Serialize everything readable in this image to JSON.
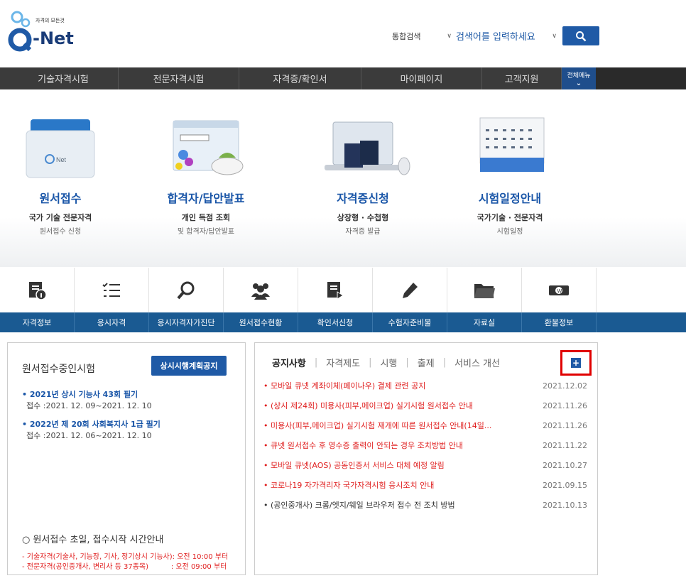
{
  "logo": {
    "tagline": "자격의 모든것",
    "brand": "-Net"
  },
  "search": {
    "scope": "통합검색",
    "placeholder": "검색어를 입력하세요"
  },
  "gnb": {
    "items": [
      "기술자격시험",
      "전문자격시험",
      "자격증/확인서",
      "마이페이지",
      "고객지원"
    ],
    "allmenu": "전체메뉴"
  },
  "quick": [
    {
      "title": "원서접수",
      "sub1": "국가 기술 전문자격",
      "sub2": "원서접수 신청"
    },
    {
      "title": "합격자/답안발표",
      "sub1": "개인 득점 조회",
      "sub2": "및 합격자/답안발표"
    },
    {
      "title": "자격증신청",
      "sub1": "상장형 · 수첩형",
      "sub2": "자격증 발급"
    },
    {
      "title": "시험일정안내",
      "sub1": "국가기술 · 전문자격",
      "sub2": "시험일정"
    }
  ],
  "icon_menu": [
    {
      "label": "자격정보",
      "icon": "document-info-icon"
    },
    {
      "label": "응시자격",
      "icon": "checklist-icon"
    },
    {
      "label": "응시자격자가진단",
      "icon": "search-icon"
    },
    {
      "label": "원서접수현황",
      "icon": "users-icon"
    },
    {
      "label": "확인서신청",
      "icon": "document-arrow-icon"
    },
    {
      "label": "수험자준비물",
      "icon": "pencil-icon"
    },
    {
      "label": "자료실",
      "icon": "folder-icon"
    },
    {
      "label": "환불정보",
      "icon": "money-icon"
    }
  ],
  "ongoing": {
    "title": "원서접수중인시험",
    "button": "상시시행계획공지",
    "exams": [
      {
        "title": "• 2021년 상시 기능사 43회 필기",
        "period": "접수 :2021. 12. 09~2021. 12. 10"
      },
      {
        "title": "• 2022년 제 20회 사회복지사 1급 필기",
        "period": "접수 :2021. 12. 06~2021. 12. 10"
      }
    ],
    "time_title": "○ 원서접수 초일, 접수시작 시간안내",
    "time_lines": [
      "- 기술자격(기술사, 기능장, 기사, 정기상시 기능사): 오전 10:00 부터",
      "- 전문자격(공인중개사, 변리사 등 37종목)          : 오전 09:00 부터"
    ]
  },
  "notice": {
    "tabs": [
      "공지사항",
      "자격제도",
      "시행",
      "출제",
      "서비스 개선"
    ],
    "more": "+",
    "items": [
      {
        "title": "• 모바일 큐넷 계좌이체(페이나우) 결제 관련 공지",
        "date": "2021.12.02",
        "color": "#e02020"
      },
      {
        "title": "• (상시 제24회) 미용사(피부,메이크업) 실기시험 원서접수 안내",
        "date": "2021.11.26",
        "color": "#e02020"
      },
      {
        "title": "• 미용사(피부,메이크업) 실기시험 재개에 따른 원서접수 안내(14일...",
        "date": "2021.11.26",
        "color": "#e02020"
      },
      {
        "title": "• 큐넷 원서접수 후 영수증 출력이 안되는 경우 조치방법 안내",
        "date": "2021.11.22",
        "color": "#e02020"
      },
      {
        "title": "• 모바일 큐넷(AOS) 공동인증서 서비스 대체 예정 알림",
        "date": "2021.10.27",
        "color": "#e02020"
      },
      {
        "title": "• 코로나19 자가격리자 국가자격시험 응시조치 안내",
        "date": "2021.09.15",
        "color": "#e02020"
      },
      {
        "title": "• (공인중개사) 크롬/엣지/웨일 브라우저 접수 전 조치 방법",
        "date": "2021.10.13",
        "color": "#333333"
      }
    ]
  }
}
